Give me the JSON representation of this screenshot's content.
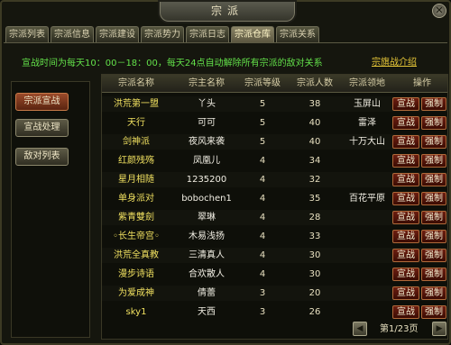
{
  "window": {
    "title": "宗派"
  },
  "tabs": [
    {
      "label": "宗派列表",
      "active": false
    },
    {
      "label": "宗派信息",
      "active": false
    },
    {
      "label": "宗派建设",
      "active": false
    },
    {
      "label": "宗派势力",
      "active": false
    },
    {
      "label": "宗派日志",
      "active": false
    },
    {
      "label": "宗派仓库",
      "active": true
    },
    {
      "label": "宗派关系",
      "active": false
    }
  ],
  "notice": "宣战时间为每天10：00－18：00，每天24点自动解除所有宗派的敌对关系",
  "intro_link": "宗旗战介绍",
  "sidebar": [
    {
      "label": "宗派宣战",
      "active": true
    },
    {
      "label": "宣战处理",
      "active": false
    },
    {
      "label": "敌对列表",
      "active": false
    }
  ],
  "table": {
    "headers": [
      "宗派名称",
      "宗主名称",
      "宗派等级",
      "宗派人数",
      "宗派领地",
      "操作"
    ],
    "action_declare": "宣战",
    "action_force": "强制",
    "rows": [
      {
        "name": "洪荒第一盟",
        "lord": "丫头",
        "level": "5",
        "members": "38",
        "territory": "玉屏山"
      },
      {
        "name": "天行",
        "lord": "可可",
        "level": "5",
        "members": "40",
        "territory": "雷泽"
      },
      {
        "name": "剑神派",
        "lord": "夜风来袭",
        "level": "5",
        "members": "40",
        "territory": "十万大山"
      },
      {
        "name": "红颜残殇",
        "lord": "凤凰儿",
        "level": "4",
        "members": "34",
        "territory": ""
      },
      {
        "name": "星月相随",
        "lord": "1235200",
        "level": "4",
        "members": "32",
        "territory": ""
      },
      {
        "name": "单身派对",
        "lord": "bobochen1",
        "level": "4",
        "members": "35",
        "territory": "百花平原"
      },
      {
        "name": "紫青雙劍",
        "lord": "翠琳",
        "level": "4",
        "members": "28",
        "territory": ""
      },
      {
        "name": "◦长生帝宫◦",
        "lord": "木易浅扬",
        "level": "4",
        "members": "33",
        "territory": ""
      },
      {
        "name": "洪荒全真教",
        "lord": "三清真人",
        "level": "4",
        "members": "30",
        "territory": ""
      },
      {
        "name": "漫步诗语",
        "lord": "合欢散人",
        "level": "4",
        "members": "30",
        "territory": ""
      },
      {
        "name": "为爱成神",
        "lord": "倩蕾",
        "level": "3",
        "members": "20",
        "territory": ""
      },
      {
        "name": "sky1",
        "lord": "天西",
        "level": "3",
        "members": "26",
        "territory": ""
      }
    ]
  },
  "pager": {
    "text": "第1/23页",
    "prev_icon": "triangle-left-icon",
    "next_icon": "triangle-right-icon"
  }
}
